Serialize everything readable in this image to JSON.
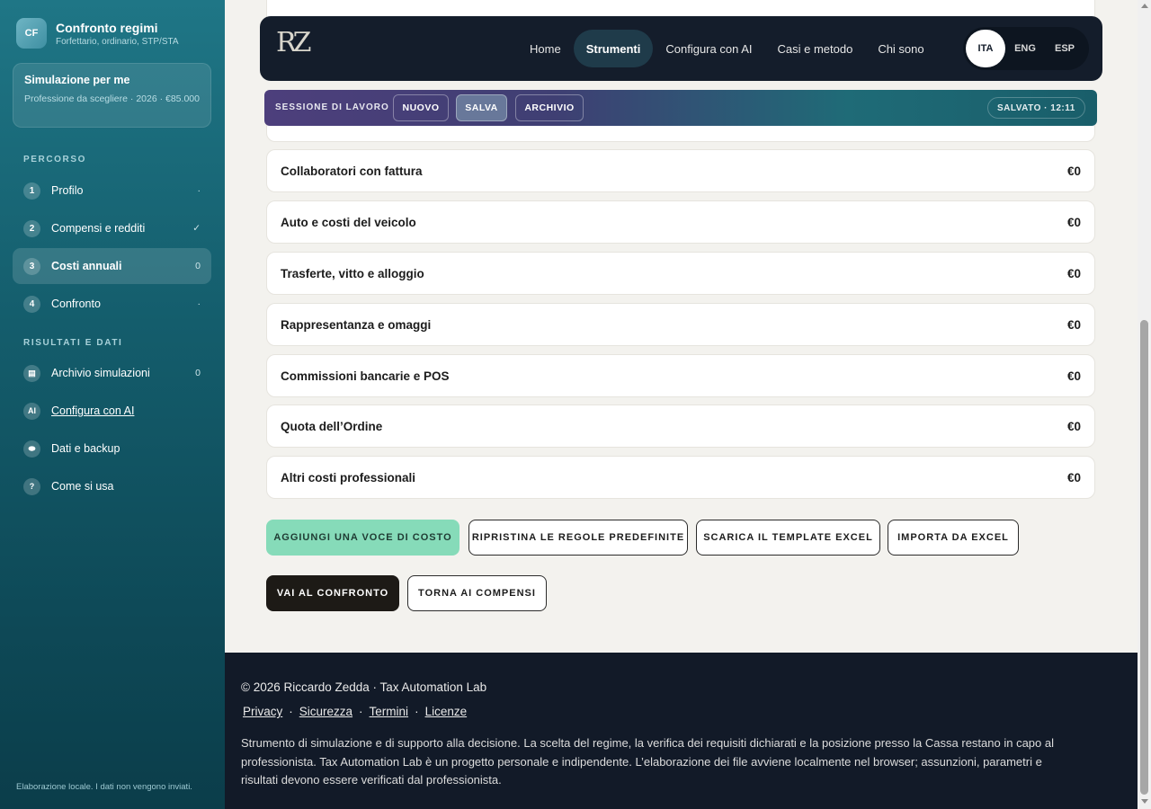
{
  "sidebar": {
    "brand": {
      "initials": "CF",
      "title": "Confronto regimi",
      "subtitle": "Forfettario, ordinario, STP/STA"
    },
    "simulation": {
      "title": "Simulazione per me",
      "desc": "Professione da scegliere · 2026 · €85.000"
    },
    "path_label": "PERCORSO",
    "steps": [
      {
        "num": "1",
        "label": "Profilo",
        "meta": "·"
      },
      {
        "num": "2",
        "label": "Compensi e redditi",
        "meta": "✓"
      },
      {
        "num": "3",
        "label": "Costi annuali",
        "meta": "0"
      },
      {
        "num": "4",
        "label": "Confronto",
        "meta": "·"
      }
    ],
    "results_label": "RISULTATI E DATI",
    "results": [
      {
        "icon": "▤",
        "label": "Archivio simulazioni",
        "meta": "0"
      },
      {
        "icon": "AI",
        "label": "Configura con AI",
        "meta": ""
      },
      {
        "icon": "⬬",
        "label": "Dati e backup",
        "meta": ""
      },
      {
        "icon": "?",
        "label": "Come si usa",
        "meta": ""
      }
    ],
    "footer": "Elaborazione locale. I dati non vengono inviati."
  },
  "header": {
    "logo": "RZ",
    "nav": [
      "Home",
      "Strumenti",
      "Configura con AI",
      "Casi e metodo",
      "Chi sono"
    ],
    "langs": [
      "ITA",
      "ENG",
      "ESP"
    ]
  },
  "session": {
    "label": "SESSIONE DI LAVORO",
    "new": "NUOVO",
    "save": "SALVA",
    "archive": "ARCHIVIO",
    "saved": "SALVATO · 12:11"
  },
  "costs": [
    {
      "label": "Collaboratori con fattura",
      "value": "€0"
    },
    {
      "label": "Auto e costi del veicolo",
      "value": "€0"
    },
    {
      "label": "Trasferte, vitto e alloggio",
      "value": "€0"
    },
    {
      "label": "Rappresentanza e omaggi",
      "value": "€0"
    },
    {
      "label": "Commissioni bancarie e POS",
      "value": "€0"
    },
    {
      "label": "Quota dell’Ordine",
      "value": "€0"
    },
    {
      "label": "Altri costi professionali",
      "value": "€0"
    }
  ],
  "actions": {
    "add": "AGGIUNGI UNA VOCE DI COSTO",
    "reset": "RIPRISTINA LE REGOLE PREDEFINITE",
    "template": "SCARICA IL TEMPLATE EXCEL",
    "import": "IMPORTA DA EXCEL",
    "compare": "VAI AL CONFRONTO",
    "back": "TORNA AI COMPENSI"
  },
  "footer": {
    "copyright": "© 2026 Riccardo Zedda · Tax Automation Lab",
    "links": [
      "Privacy",
      "Sicurezza",
      "Termini",
      "Licenze"
    ],
    "separator": "·",
    "disclaimer": "Strumento di simulazione e di supporto alla decisione. La scelta del regime, la verifica dei requisiti dichiarati e la posizione presso la Cassa restano in capo al professionista. Tax Automation Lab è un progetto personale e indipendente. L’elaborazione dei file avviene localmente nel browser; assunzioni, parametri e risultati devono essere verificati dal professionista."
  }
}
